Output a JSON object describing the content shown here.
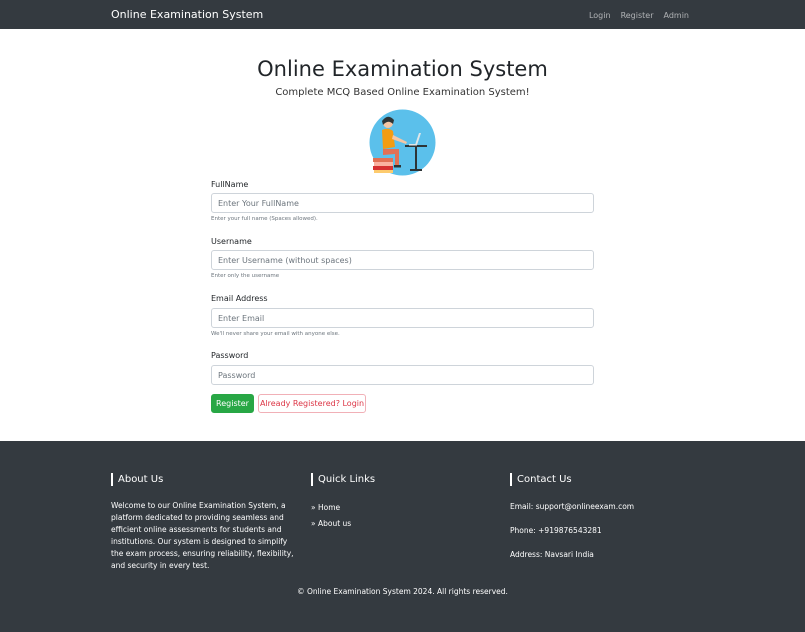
{
  "navbar": {
    "brand": "Online Examination System",
    "links": [
      "Login",
      "Register",
      "Admin"
    ]
  },
  "hero": {
    "title": "Online Examination System",
    "subtitle": "Complete MCQ Based Online Examination System!"
  },
  "form": {
    "fullname": {
      "label": "FullName",
      "placeholder": "Enter Your FullName",
      "help": "Enter your full name (Spaces allowed)."
    },
    "username": {
      "label": "Username",
      "placeholder": "Enter Username (without spaces)",
      "help": "Enter only the username"
    },
    "email": {
      "label": "Email Address",
      "placeholder": "Enter Email",
      "help": "We'll never share your email with anyone else."
    },
    "password": {
      "label": "Password",
      "placeholder": "Password"
    },
    "register_button": "Register",
    "login_button": "Already Registered? Login"
  },
  "footer": {
    "about": {
      "title": "About Us",
      "text": "Welcome to our Online Examination System, a platform dedicated to providing seamless and efficient online assessments for students and institutions. Our system is designed to simplify the exam process, ensuring reliability, flexibility, and security in every test."
    },
    "quick_links": {
      "title": "Quick Links",
      "items": [
        "» Home",
        "» About us"
      ]
    },
    "contact": {
      "title": "Contact Us",
      "email": "Email: support@onlineexam.com",
      "phone": "Phone: +919876543281",
      "address": "Address: Navsari India"
    },
    "copyright": "© Online Examination System 2024. All rights reserved."
  },
  "colors": {
    "navbar_bg": "#343a40",
    "footer_bg": "#343a40",
    "success": "#28a745",
    "danger": "#dc3545"
  }
}
